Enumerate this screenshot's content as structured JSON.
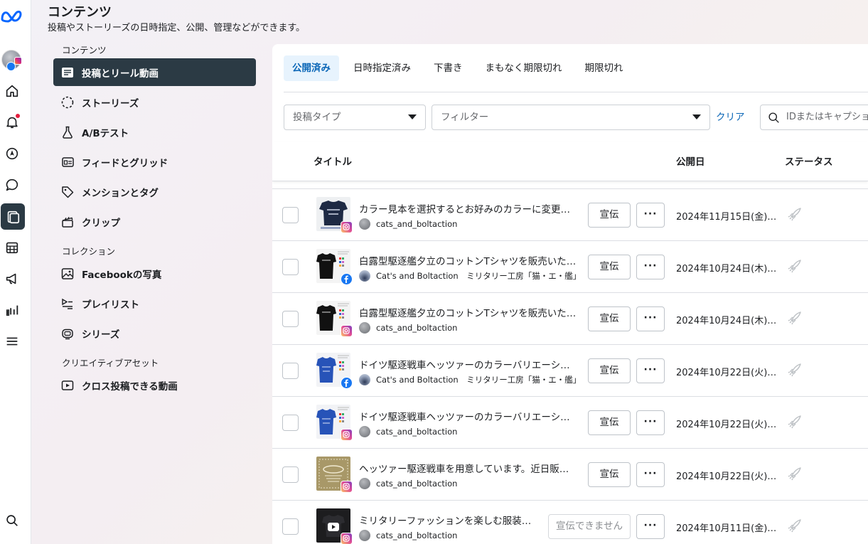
{
  "header": {
    "title": "コンテンツ",
    "subtitle": "投稿やストーリーズの日時指定、公開、管理などができます。"
  },
  "sidebar": {
    "section_content": "コンテンツ",
    "section_collection": "コレクション",
    "section_creative": "クリエイティブアセット",
    "items": [
      {
        "label": "投稿とリール動画",
        "icon": "post-icon",
        "active": true
      },
      {
        "label": "ストーリーズ",
        "icon": "story-icon"
      },
      {
        "label": "A/Bテスト",
        "icon": "flask-icon"
      },
      {
        "label": "フィードとグリッド",
        "icon": "feed-grid-icon"
      },
      {
        "label": "メンションとタグ",
        "icon": "tag-icon"
      },
      {
        "label": "クリップ",
        "icon": "clapper-icon"
      },
      {
        "label": "Facebookの写真",
        "icon": "photo-icon"
      },
      {
        "label": "プレイリスト",
        "icon": "playlist-icon"
      },
      {
        "label": "シリーズ",
        "icon": "series-icon"
      },
      {
        "label": "クロス投稿できる動画",
        "icon": "video-icon"
      }
    ]
  },
  "tabs": [
    {
      "label": "公開済み",
      "active": true
    },
    {
      "label": "日時指定済み"
    },
    {
      "label": "下書き"
    },
    {
      "label": "まもなく期限切れ"
    },
    {
      "label": "期限切れ"
    }
  ],
  "filters": {
    "post_type": "投稿タイプ",
    "filter": "フィルター",
    "clear": "クリア",
    "search_placeholder": "IDまたはキャプション"
  },
  "table": {
    "columns": {
      "title": "タイトル",
      "published": "公開日",
      "status": "ステータス"
    },
    "rows": [
      {
        "title": "カラー見本を選択するとお好みのカラーに変更…",
        "account": "cats_and_boltaction",
        "platform": "instagram",
        "promote": "宣伝",
        "date": "2024年11月15日(金)…",
        "thumb": "navy"
      },
      {
        "title": "白露型駆逐艦夕立のコットンTシャツを販売いた…",
        "account": "Cat's and Boltaction　ミリタリー工房「猫・エ・艦」",
        "platform": "facebook",
        "promote": "宣伝",
        "date": "2024年10月24日(木)…",
        "thumb": "black"
      },
      {
        "title": "白露型駆逐艦夕立のコットンTシャツを販売いた…",
        "account": "cats_and_boltaction",
        "platform": "instagram",
        "promote": "宣伝",
        "date": "2024年10月24日(木)…",
        "thumb": "black"
      },
      {
        "title": "ドイツ駆逐戦車ヘッツァーのカラーバリエーシ…",
        "account": "Cat's and Boltaction　ミリタリー工房「猫・エ・艦」",
        "platform": "facebook",
        "promote": "宣伝",
        "date": "2024年10月22日(火)…",
        "thumb": "blue"
      },
      {
        "title": "ドイツ駆逐戦車ヘッツァーのカラーバリエーシ…",
        "account": "cats_and_boltaction",
        "platform": "instagram",
        "promote": "宣伝",
        "date": "2024年10月22日(火)…",
        "thumb": "blue"
      },
      {
        "title": "ヘッツァー駆逐戦車を用意しています。近日販…",
        "account": "cats_and_boltaction",
        "platform": "instagram",
        "promote": "宣伝",
        "date": "2024年10月22日(火)…",
        "thumb": "khaki"
      },
      {
        "title": "ミリタリーファッションを楽しむ服装…",
        "account": "cats_and_boltaction",
        "platform": "instagram",
        "promote": "宣伝できません",
        "promote_disabled": true,
        "date": "2024年10月11日(金)…",
        "thumb": "reel"
      }
    ],
    "more_label": "···"
  },
  "colors": {
    "active_nav_bg": "#2b3a44",
    "tab_active_bg": "#e7f3fd",
    "link_blue": "#0a66b7"
  }
}
